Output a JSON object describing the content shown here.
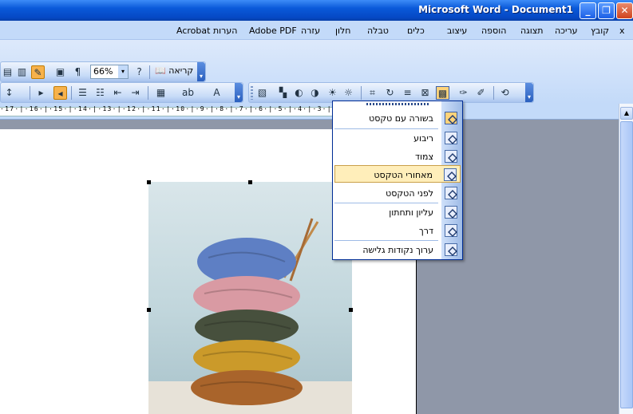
{
  "window": {
    "title": "Microsoft Word - Document1",
    "min_symbol": "_",
    "max_symbol": "❐",
    "close_symbol": "✕"
  },
  "menubar": {
    "close_symbol": "x",
    "items": [
      {
        "label": "קובץ"
      },
      {
        "label": "עריכה"
      },
      {
        "label": "תצוגה"
      },
      {
        "label": "הוספה"
      },
      {
        "label": "עיצוב"
      },
      {
        "label": "כלים"
      },
      {
        "label": "טבלה"
      },
      {
        "label": "חלון"
      },
      {
        "label": "עזרה"
      },
      {
        "label": "Adobe PDF"
      },
      {
        "label": "Acrobat הערות"
      }
    ]
  },
  "toolbar": {
    "zoom_value": "66%",
    "zoom_arrow": "▾",
    "pilcrow": "¶",
    "reading_label": "קריאה",
    "chevron": "▾"
  },
  "ruler": {
    "labels": "·17·|·16·|·15·|·14·|·13·|·12·|·11·|·10·|·9·|·8·|·7·|·6·|·5·|·4·|·3·|·2·|·1·|"
  },
  "wrap_menu": {
    "items": [
      {
        "label": "בשורה עם טקסט",
        "icon": "inline-with-text-icon",
        "selected_icon": true
      },
      {
        "label": "ריבוע",
        "icon": "square-wrap-icon"
      },
      {
        "label": "צמוד",
        "icon": "tight-wrap-icon"
      },
      {
        "label": "מאחורי הטקסט",
        "icon": "behind-text-icon",
        "hover": true
      },
      {
        "label": "לפני הטקסט",
        "icon": "in-front-of-text-icon"
      },
      {
        "label": "עליון ותחתון",
        "icon": "top-and-bottom-icon"
      },
      {
        "label": "דרך",
        "icon": "through-wrap-icon"
      },
      {
        "label": "ערוך נקודות גלישה",
        "icon": "edit-wrap-points-icon"
      }
    ]
  },
  "colors": {
    "title_bar": "#0a59d9",
    "menu_bg": "#c3daf9",
    "hover_item": "#ffeeba",
    "doc_background": "#8f97a8"
  },
  "scrollbar": {
    "up_arrow": "▲"
  },
  "image": {
    "subject": "yarn-balls-stack"
  }
}
